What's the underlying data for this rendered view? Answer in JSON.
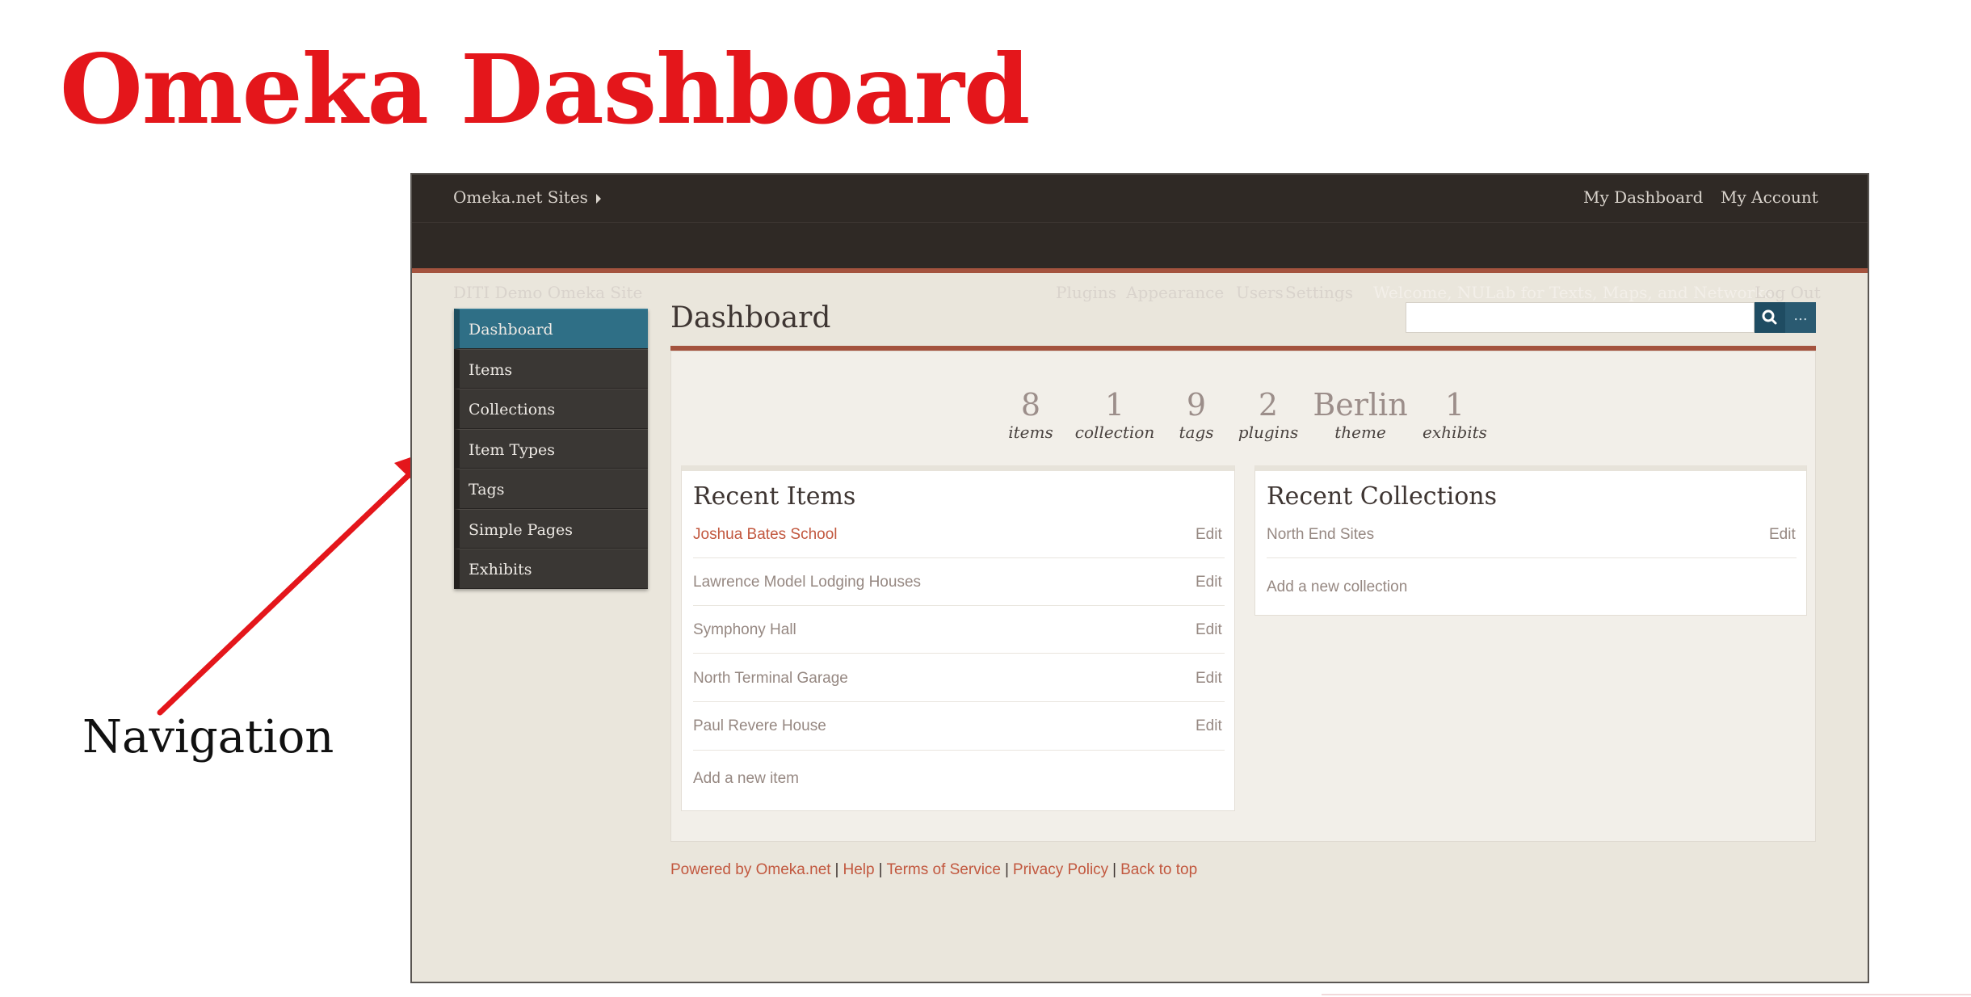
{
  "slide": {
    "title": "Omeka Dashboard",
    "callout": "Navigation"
  },
  "topbar": {
    "sites_link": "Omeka.net Sites",
    "my_dashboard": "My Dashboard",
    "my_account": "My Account"
  },
  "sitebar": {
    "site_name": "DITI Demo Omeka Site",
    "nav": [
      "Plugins",
      "Appearance",
      "Users",
      "Settings"
    ],
    "welcome": "Welcome, NULab for Texts, Maps, and Networks",
    "logout": "Log Out"
  },
  "sidebar": {
    "items": [
      {
        "label": "Dashboard",
        "active": true
      },
      {
        "label": "Items"
      },
      {
        "label": "Collections"
      },
      {
        "label": "Item Types"
      },
      {
        "label": "Tags"
      },
      {
        "label": "Simple Pages"
      },
      {
        "label": "Exhibits"
      }
    ]
  },
  "main": {
    "page_title": "Dashboard",
    "search": {
      "value": "",
      "placeholder": "",
      "advanced_label": "..."
    },
    "stats": [
      {
        "value": "8",
        "label": "items"
      },
      {
        "value": "1",
        "label": "collection"
      },
      {
        "value": "9",
        "label": "tags"
      },
      {
        "value": "2",
        "label": "plugins"
      },
      {
        "value": "Berlin",
        "label": "theme"
      },
      {
        "value": "1",
        "label": "exhibits"
      }
    ],
    "recent_items": {
      "title": "Recent Items",
      "rows": [
        {
          "name": "Joshua Bates School",
          "edit": "Edit"
        },
        {
          "name": "Lawrence Model Lodging Houses",
          "edit": "Edit"
        },
        {
          "name": "Symphony Hall",
          "edit": "Edit"
        },
        {
          "name": "North Terminal Garage",
          "edit": "Edit"
        },
        {
          "name": "Paul Revere House",
          "edit": "Edit"
        }
      ],
      "add_label": "Add a new item"
    },
    "recent_collections": {
      "title": "Recent Collections",
      "rows": [
        {
          "name": "North End Sites",
          "edit": "Edit"
        }
      ],
      "add_label": "Add a new collection"
    }
  },
  "footer": {
    "links": [
      "Powered by Omeka.net",
      "Help",
      "Terms of Service",
      "Privacy Policy",
      "Back to top"
    ],
    "separator": "|"
  },
  "colors": {
    "slide_title": "#e4161b",
    "header_bg": "#2f2925",
    "accent": "#a4533e",
    "sidebar_active": "#2f6f86",
    "link": "#c2583f"
  }
}
